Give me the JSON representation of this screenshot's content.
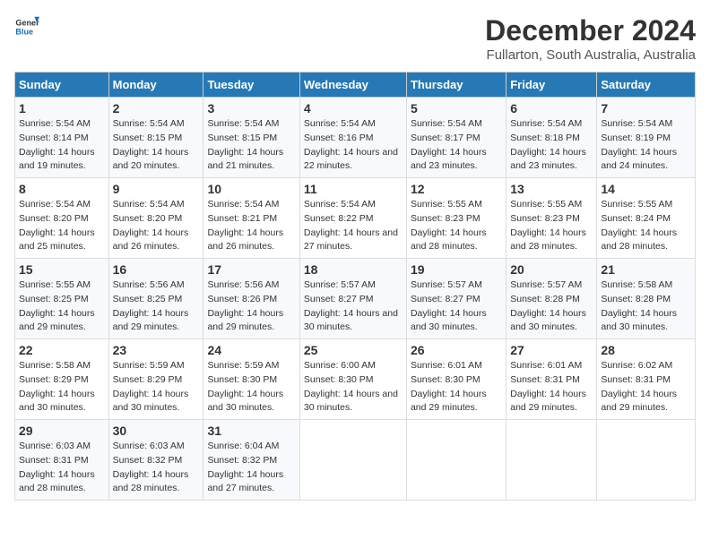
{
  "logo": {
    "general": "General",
    "blue": "Blue"
  },
  "title": "December 2024",
  "subtitle": "Fullarton, South Australia, Australia",
  "headers": [
    "Sunday",
    "Monday",
    "Tuesday",
    "Wednesday",
    "Thursday",
    "Friday",
    "Saturday"
  ],
  "weeks": [
    [
      {
        "day": "1",
        "sunrise": "5:54 AM",
        "sunset": "8:14 PM",
        "daylight": "14 hours and 19 minutes."
      },
      {
        "day": "2",
        "sunrise": "5:54 AM",
        "sunset": "8:15 PM",
        "daylight": "14 hours and 20 minutes."
      },
      {
        "day": "3",
        "sunrise": "5:54 AM",
        "sunset": "8:15 PM",
        "daylight": "14 hours and 21 minutes."
      },
      {
        "day": "4",
        "sunrise": "5:54 AM",
        "sunset": "8:16 PM",
        "daylight": "14 hours and 22 minutes."
      },
      {
        "day": "5",
        "sunrise": "5:54 AM",
        "sunset": "8:17 PM",
        "daylight": "14 hours and 23 minutes."
      },
      {
        "day": "6",
        "sunrise": "5:54 AM",
        "sunset": "8:18 PM",
        "daylight": "14 hours and 23 minutes."
      },
      {
        "day": "7",
        "sunrise": "5:54 AM",
        "sunset": "8:19 PM",
        "daylight": "14 hours and 24 minutes."
      }
    ],
    [
      {
        "day": "8",
        "sunrise": "5:54 AM",
        "sunset": "8:20 PM",
        "daylight": "14 hours and 25 minutes."
      },
      {
        "day": "9",
        "sunrise": "5:54 AM",
        "sunset": "8:20 PM",
        "daylight": "14 hours and 26 minutes."
      },
      {
        "day": "10",
        "sunrise": "5:54 AM",
        "sunset": "8:21 PM",
        "daylight": "14 hours and 26 minutes."
      },
      {
        "day": "11",
        "sunrise": "5:54 AM",
        "sunset": "8:22 PM",
        "daylight": "14 hours and 27 minutes."
      },
      {
        "day": "12",
        "sunrise": "5:55 AM",
        "sunset": "8:23 PM",
        "daylight": "14 hours and 28 minutes."
      },
      {
        "day": "13",
        "sunrise": "5:55 AM",
        "sunset": "8:23 PM",
        "daylight": "14 hours and 28 minutes."
      },
      {
        "day": "14",
        "sunrise": "5:55 AM",
        "sunset": "8:24 PM",
        "daylight": "14 hours and 28 minutes."
      }
    ],
    [
      {
        "day": "15",
        "sunrise": "5:55 AM",
        "sunset": "8:25 PM",
        "daylight": "14 hours and 29 minutes."
      },
      {
        "day": "16",
        "sunrise": "5:56 AM",
        "sunset": "8:25 PM",
        "daylight": "14 hours and 29 minutes."
      },
      {
        "day": "17",
        "sunrise": "5:56 AM",
        "sunset": "8:26 PM",
        "daylight": "14 hours and 29 minutes."
      },
      {
        "day": "18",
        "sunrise": "5:57 AM",
        "sunset": "8:27 PM",
        "daylight": "14 hours and 30 minutes."
      },
      {
        "day": "19",
        "sunrise": "5:57 AM",
        "sunset": "8:27 PM",
        "daylight": "14 hours and 30 minutes."
      },
      {
        "day": "20",
        "sunrise": "5:57 AM",
        "sunset": "8:28 PM",
        "daylight": "14 hours and 30 minutes."
      },
      {
        "day": "21",
        "sunrise": "5:58 AM",
        "sunset": "8:28 PM",
        "daylight": "14 hours and 30 minutes."
      }
    ],
    [
      {
        "day": "22",
        "sunrise": "5:58 AM",
        "sunset": "8:29 PM",
        "daylight": "14 hours and 30 minutes."
      },
      {
        "day": "23",
        "sunrise": "5:59 AM",
        "sunset": "8:29 PM",
        "daylight": "14 hours and 30 minutes."
      },
      {
        "day": "24",
        "sunrise": "5:59 AM",
        "sunset": "8:30 PM",
        "daylight": "14 hours and 30 minutes."
      },
      {
        "day": "25",
        "sunrise": "6:00 AM",
        "sunset": "8:30 PM",
        "daylight": "14 hours and 30 minutes."
      },
      {
        "day": "26",
        "sunrise": "6:01 AM",
        "sunset": "8:30 PM",
        "daylight": "14 hours and 29 minutes."
      },
      {
        "day": "27",
        "sunrise": "6:01 AM",
        "sunset": "8:31 PM",
        "daylight": "14 hours and 29 minutes."
      },
      {
        "day": "28",
        "sunrise": "6:02 AM",
        "sunset": "8:31 PM",
        "daylight": "14 hours and 29 minutes."
      }
    ],
    [
      {
        "day": "29",
        "sunrise": "6:03 AM",
        "sunset": "8:31 PM",
        "daylight": "14 hours and 28 minutes."
      },
      {
        "day": "30",
        "sunrise": "6:03 AM",
        "sunset": "8:32 PM",
        "daylight": "14 hours and 28 minutes."
      },
      {
        "day": "31",
        "sunrise": "6:04 AM",
        "sunset": "8:32 PM",
        "daylight": "14 hours and 27 minutes."
      },
      null,
      null,
      null,
      null
    ]
  ]
}
